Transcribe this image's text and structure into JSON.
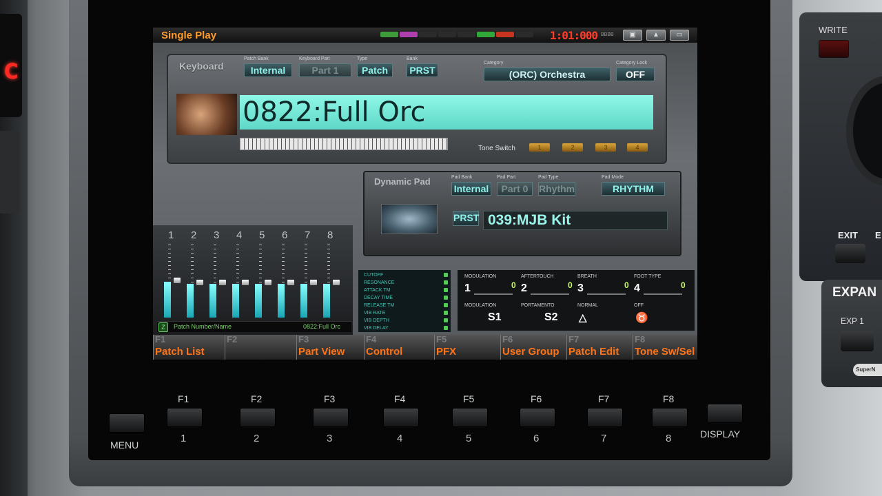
{
  "header": {
    "mode_title": "Single Play",
    "clock": "1:01:000",
    "midi_colors": [
      "#3e9c3a",
      "#b03fae",
      "#2b2b2b",
      "#2b2b2b",
      "#2b2b2b",
      "#30a83a",
      "#c93420",
      "#2b2b2b"
    ]
  },
  "keyboard_section": {
    "label": "Keyboard",
    "bank": "Internal",
    "part": "Part 1",
    "type": "Patch",
    "bank_group": "PRST",
    "category": "(ORC) Orchestra",
    "lock": "OFF",
    "patch_name": "0822:Full Orc",
    "tone_switch_label": "Tone Switch",
    "tone_switches": [
      "1",
      "2",
      "3",
      "4"
    ]
  },
  "pad_section": {
    "label": "Dynamic Pad",
    "bank": "Internal",
    "part": "Part 0",
    "type": "Rhythm",
    "mode": "RHYTHM",
    "bank_group": "PRST",
    "kit_name": "039:MJB Kit"
  },
  "mixer": {
    "channels": [
      "1",
      "2",
      "3",
      "4",
      "5",
      "6",
      "7",
      "8"
    ],
    "levels": [
      0.5,
      0.47,
      0.47,
      0.47,
      0.47,
      0.47,
      0.47,
      0.47
    ],
    "footer_icon": "Z",
    "footer_label": "Patch Number/Name",
    "footer_value": "0822:Full Orc"
  },
  "controls": {
    "list": [
      "CUTOFF",
      "RESONANCE",
      "ATTACK TM",
      "DECAY TIME",
      "RELEASE TM",
      "VIB RATE",
      "VIB DEPTH",
      "VIB DELAY"
    ],
    "cc": [
      {
        "label": "MODULATION",
        "ch": "1",
        "value": "0"
      },
      {
        "label": "AFTERTOUCH",
        "ch": "2",
        "value": "0"
      },
      {
        "label": "BREATH",
        "ch": "3",
        "value": "0"
      },
      {
        "label": "FOOT TYPE",
        "ch": "4",
        "value": "0"
      }
    ],
    "switches": [
      {
        "label": "MODULATION",
        "value": "S1"
      },
      {
        "label": "PORTAMENTO",
        "value": "S2"
      },
      {
        "label": "NORMAL",
        "value": ""
      },
      {
        "label": "OFF",
        "value": ""
      }
    ]
  },
  "function_row": [
    {
      "num": "F1",
      "label": "Patch List"
    },
    {
      "num": "F2",
      "label": ""
    },
    {
      "num": "F3",
      "label": "Part View"
    },
    {
      "num": "F4",
      "label": "Control"
    },
    {
      "num": "F5",
      "label": "PFX"
    },
    {
      "num": "F6",
      "label": "User Group"
    },
    {
      "num": "F7",
      "label": "Patch Edit"
    },
    {
      "num": "F8",
      "label": "Tone Sw/Sel"
    }
  ],
  "hardware": {
    "f_labels": [
      "F1",
      "F2",
      "F3",
      "F4",
      "F5",
      "F6",
      "F7",
      "F8"
    ],
    "numbers": [
      "1",
      "2",
      "3",
      "4",
      "5",
      "6",
      "7",
      "8"
    ],
    "menu": "MENU",
    "display": "DISPLAY",
    "write": "WRITE",
    "exit": "EXIT",
    "e": "E",
    "expan": "EXPAN",
    "exp1": "EXP 1",
    "badge": "SuperN"
  }
}
